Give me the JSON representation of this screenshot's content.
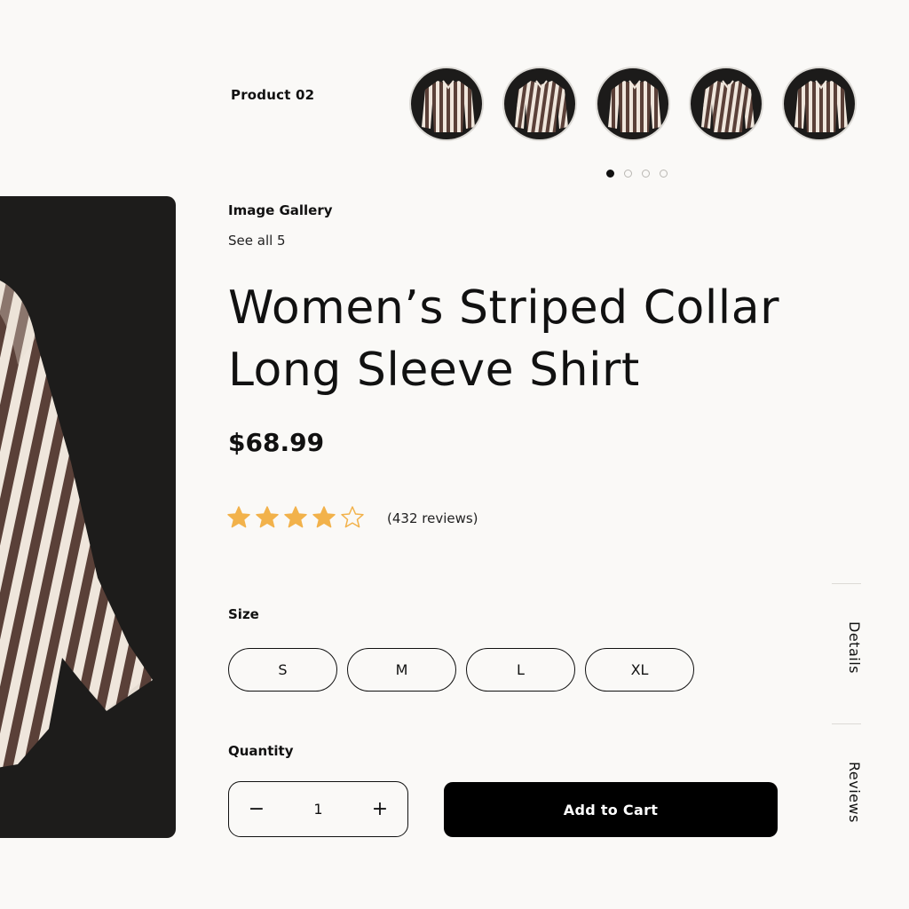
{
  "header": {
    "product_label": "Product 02"
  },
  "gallery": {
    "thumbnails": [
      "shirt-front",
      "shirt-open",
      "shirt-collar",
      "shirt-flat",
      "shirt-back"
    ],
    "active_dot": 0,
    "dot_count": 4,
    "title": "Image Gallery",
    "see_all": "See all 5"
  },
  "product": {
    "title_line1": "Women’s Striped Collar",
    "title_line2": "Long Sleeve Shirt",
    "price": "$68.99",
    "rating": 4,
    "rating_max": 5,
    "reviews": "(432 reviews)"
  },
  "size": {
    "label": "Size",
    "options": [
      "S",
      "M",
      "L",
      "XL"
    ]
  },
  "quantity": {
    "label": "Quantity",
    "value": "1",
    "minus": "−",
    "plus": "+"
  },
  "cart": {
    "label": "Add to Cart"
  },
  "side_tabs": {
    "details": "Details",
    "reviews": "Reviews"
  },
  "colors": {
    "background": "#faf9f7",
    "stripe_dark": "#5a4038",
    "stripe_light": "#efe6dc",
    "star": "#f2b24b",
    "button": "#000000"
  }
}
